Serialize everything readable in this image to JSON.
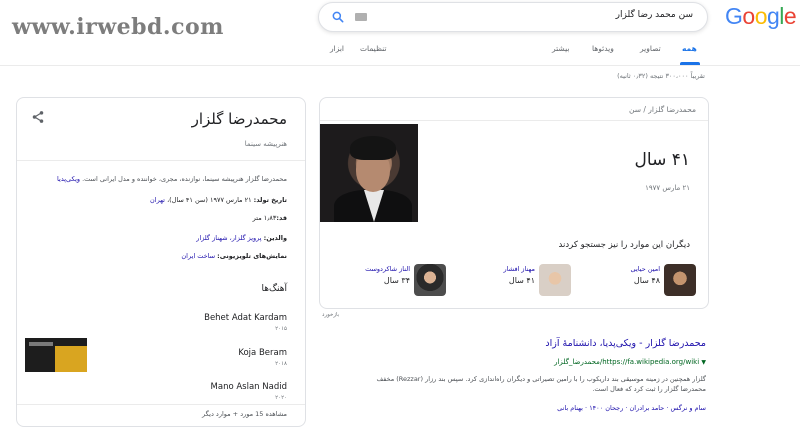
{
  "watermark": "www.irwebd.com",
  "logo": [
    "G",
    "o",
    "o",
    "g",
    "l",
    "e"
  ],
  "search": {
    "query": "سن محمد رضا گلزار"
  },
  "tabs": {
    "all": "همه",
    "images": "تصاویر",
    "videos": "ویدئوها",
    "more": "بیشتر",
    "settings": "تنظیمات",
    "tools": "ابزار"
  },
  "results_stats": "تقریباً ۳۰۰،۰۰۰ نتیجه (۰٫۳۲ ثانیه)",
  "answer_card": {
    "breadcrumb": "محمدرضا گلزار / سن",
    "age": "۴۱ سال",
    "birth_date": "۲۱ مارس ۱۹۷۷",
    "also_search_title": "دیگران این موارد را نیز جستجو کردند",
    "people": [
      {
        "name": "امین حیایی",
        "age": "۴۸ سال"
      },
      {
        "name": "مهناز افشار",
        "age": "۴۱ سال"
      },
      {
        "name": "الناز شاکردوست",
        "age": "۳۴ سال"
      }
    ]
  },
  "feedback": "بازخورد",
  "result": {
    "title": "محمدرضا گلزار - ویکی‌پدیا، دانشنامهٔ آزاد",
    "url": "https://fa.wikipedia.org/wiki/محمدرضا_گلزار",
    "snippet": "گلزار همچنین در زمینه موسیقی بند داریکوب را با رامین تصیراتی و دیگران راه‌اندازی کرد. سپس بند رزار (Rezzar) مخفف محمدرضا گلزار را ثبت کرد که فعال است.",
    "sitelinks": "سام و نرگس · حامد برادران · رجحان ۱۴۰۰ · بهنام بانی"
  },
  "knowledge_panel": {
    "title": "محمدرضا گلزار",
    "subtitle": "هنرپیشه سینما",
    "description": "محمدرضا گلزار هنرپیشه سینما، نوازنده، مجری، خواننده و مدل ایرانی است.",
    "description_link": "ویکی‌پدیا",
    "facts": [
      {
        "label": "تاریخ تولد:",
        "value": "۲۱ مارس ۱۹۷۷ (سن ۴۱ سال)، ",
        "link": "تهران"
      },
      {
        "label": "قد:",
        "value": "۱٫۸۳ متر",
        "link": ""
      },
      {
        "label": "والدین:",
        "value": "",
        "link": "پرویز گلزار، شهناز گلزار"
      },
      {
        "label": "نمایش‌های تلویزیونی:",
        "value": "",
        "link": "ساخت ایران"
      }
    ],
    "songs_heading": "آهنگ‌ها",
    "songs": [
      {
        "title": "Behet Adat Kardam",
        "year": "۲۰۱۵"
      },
      {
        "title": "Koja Beram",
        "year": "۲۰۱۸"
      },
      {
        "title": "Mano Aslan Nadid",
        "year": "۲۰۲۰"
      }
    ],
    "more": "مشاهده 15 مورد + موارد دیگر"
  },
  "colors": {
    "link": "#1a0dab",
    "url_green": "#006621",
    "accent": "#1a73e8"
  }
}
